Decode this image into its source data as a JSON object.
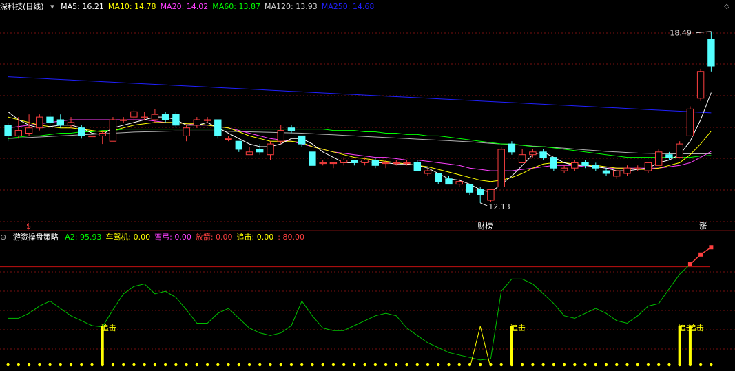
{
  "colors": {
    "bg": "#000000",
    "grid": "#7a1010",
    "up": "#ff4040",
    "down": "#54ffff",
    "ma5": "#ffffff",
    "ma10": "#ffff00",
    "ma20": "#ff40ff",
    "ma60": "#00ff00",
    "ma120": "#b0b0b0",
    "ma250": "#2020ff",
    "osc": "#00c000",
    "signal": "#ffff00",
    "ref": "#c01010",
    "label_red": "#ff4040"
  },
  "main_panel": {
    "title": "深科技(日线)",
    "legend": [
      {
        "key": "ma5",
        "label": "MA5:",
        "value": "16.21",
        "color": "#ffffff"
      },
      {
        "key": "ma10",
        "label": "MA10:",
        "value": "14.78",
        "color": "#ffff00"
      },
      {
        "key": "ma20",
        "label": "MA20:",
        "value": "14.02",
        "color": "#ff40ff"
      },
      {
        "key": "ma60",
        "label": "MA60:",
        "value": "13.87",
        "color": "#00ff00"
      },
      {
        "key": "ma120",
        "label": "MA120:",
        "value": "13.93",
        "color": "#d0d0d0"
      },
      {
        "key": "ma250",
        "label": "MA250:",
        "value": "14.68",
        "color": "#2020ff"
      }
    ],
    "high_marker": "18.49",
    "low_marker": "12.13",
    "event_labels": {
      "left": "$",
      "mid": "财榜",
      "right": "涨"
    }
  },
  "sub_panel": {
    "title": "游资操盘策略",
    "legend": [
      {
        "label": "A2:",
        "value": "95.93",
        "color": "#00ff00"
      },
      {
        "label": "车驾机:",
        "value": "0.00",
        "color": "#ffff00"
      },
      {
        "label": "弯弓:",
        "value": "0.00",
        "color": "#ff40ff"
      },
      {
        "label": "放箭:",
        "value": "0.00",
        "color": "#ff4040"
      },
      {
        "label": "追击:",
        "value": "0.00",
        "color": "#ffff00"
      },
      {
        "label": ":",
        "value": "80.00",
        "color": "#ff4040"
      }
    ],
    "signal_label": "追击"
  },
  "chart_data": {
    "type": "candlestick",
    "price_range": [
      11.2,
      19.2
    ],
    "candles": [
      {
        "o": 15.0,
        "c": 14.6,
        "h": 15.1,
        "l": 14.4
      },
      {
        "o": 14.6,
        "c": 14.8,
        "h": 15.3,
        "l": 14.5
      },
      {
        "o": 14.7,
        "c": 14.9,
        "h": 15.4,
        "l": 14.6
      },
      {
        "o": 14.9,
        "c": 15.3,
        "h": 15.4,
        "l": 14.8
      },
      {
        "o": 15.3,
        "c": 15.1,
        "h": 15.5,
        "l": 14.9
      },
      {
        "o": 15.2,
        "c": 15.0,
        "h": 15.4,
        "l": 14.9
      },
      {
        "o": 15.0,
        "c": 15.1,
        "h": 15.3,
        "l": 14.9
      },
      {
        "o": 14.9,
        "c": 14.6,
        "h": 15.0,
        "l": 14.5
      },
      {
        "o": 14.6,
        "c": 14.6,
        "h": 14.8,
        "l": 14.3
      },
      {
        "o": 14.6,
        "c": 14.7,
        "h": 14.8,
        "l": 14.3
      },
      {
        "o": 14.4,
        "c": 15.2,
        "h": 15.3,
        "l": 14.4
      },
      {
        "o": 15.2,
        "c": 15.2,
        "h": 15.3,
        "l": 15.1
      },
      {
        "o": 15.3,
        "c": 15.5,
        "h": 15.6,
        "l": 15.1
      },
      {
        "o": 15.3,
        "c": 15.3,
        "h": 15.5,
        "l": 15.2
      },
      {
        "o": 15.2,
        "c": 15.4,
        "h": 15.6,
        "l": 15.1
      },
      {
        "o": 15.4,
        "c": 15.2,
        "h": 15.5,
        "l": 15.1
      },
      {
        "o": 15.4,
        "c": 15.0,
        "h": 15.5,
        "l": 14.9
      },
      {
        "o": 14.6,
        "c": 14.9,
        "h": 15.0,
        "l": 14.4
      },
      {
        "o": 15.0,
        "c": 15.2,
        "h": 15.3,
        "l": 14.9
      },
      {
        "o": 15.2,
        "c": 15.2,
        "h": 15.3,
        "l": 15.1
      },
      {
        "o": 15.2,
        "c": 14.6,
        "h": 15.2,
        "l": 14.5
      },
      {
        "o": 14.5,
        "c": 14.5,
        "h": 14.6,
        "l": 14.4
      },
      {
        "o": 14.4,
        "c": 14.1,
        "h": 14.4,
        "l": 14.0
      },
      {
        "o": 13.9,
        "c": 14.0,
        "h": 14.2,
        "l": 13.9
      },
      {
        "o": 14.1,
        "c": 14.0,
        "h": 14.3,
        "l": 13.9
      },
      {
        "o": 13.9,
        "c": 14.3,
        "h": 14.4,
        "l": 13.7
      },
      {
        "o": 14.4,
        "c": 14.8,
        "h": 15.0,
        "l": 14.3
      },
      {
        "o": 14.9,
        "c": 14.8,
        "h": 15.0,
        "l": 14.7
      },
      {
        "o": 14.6,
        "c": 14.3,
        "h": 14.6,
        "l": 14.2
      },
      {
        "o": 14.0,
        "c": 13.5,
        "h": 14.0,
        "l": 13.5
      },
      {
        "o": 13.6,
        "c": 13.6,
        "h": 13.7,
        "l": 13.5
      },
      {
        "o": 13.6,
        "c": 13.6,
        "h": 13.6,
        "l": 13.4
      },
      {
        "o": 13.6,
        "c": 13.7,
        "h": 13.8,
        "l": 13.5
      },
      {
        "o": 13.7,
        "c": 13.6,
        "h": 13.7,
        "l": 13.5
      },
      {
        "o": 13.6,
        "c": 13.7,
        "h": 13.8,
        "l": 13.5
      },
      {
        "o": 13.7,
        "c": 13.5,
        "h": 13.8,
        "l": 13.4
      },
      {
        "o": 13.6,
        "c": 13.6,
        "h": 13.7,
        "l": 13.4
      },
      {
        "o": 13.6,
        "c": 13.6,
        "h": 13.7,
        "l": 13.5
      },
      {
        "o": 13.6,
        "c": 13.6,
        "h": 13.7,
        "l": 13.5
      },
      {
        "o": 13.6,
        "c": 13.3,
        "h": 13.7,
        "l": 13.3
      },
      {
        "o": 13.2,
        "c": 13.3,
        "h": 13.4,
        "l": 13.1
      },
      {
        "o": 13.2,
        "c": 12.9,
        "h": 13.2,
        "l": 12.8
      },
      {
        "o": 13.0,
        "c": 12.8,
        "h": 13.1,
        "l": 12.8
      },
      {
        "o": 12.8,
        "c": 12.9,
        "h": 13.0,
        "l": 12.7
      },
      {
        "o": 12.8,
        "c": 12.5,
        "h": 12.8,
        "l": 12.4
      },
      {
        "o": 12.6,
        "c": 12.4,
        "h": 12.7,
        "l": 12.1
      },
      {
        "o": 12.2,
        "c": 12.6,
        "h": 12.6,
        "l": 12.13
      },
      {
        "o": 12.7,
        "c": 14.1,
        "h": 14.2,
        "l": 12.7
      },
      {
        "o": 14.3,
        "c": 14.0,
        "h": 14.4,
        "l": 13.9
      },
      {
        "o": 13.6,
        "c": 13.9,
        "h": 14.1,
        "l": 13.6
      },
      {
        "o": 13.9,
        "c": 14.0,
        "h": 14.1,
        "l": 13.8
      },
      {
        "o": 14.0,
        "c": 13.8,
        "h": 14.1,
        "l": 13.7
      },
      {
        "o": 13.8,
        "c": 13.4,
        "h": 13.8,
        "l": 13.3
      },
      {
        "o": 13.3,
        "c": 13.4,
        "h": 13.5,
        "l": 13.2
      },
      {
        "o": 13.4,
        "c": 13.6,
        "h": 13.7,
        "l": 13.3
      },
      {
        "o": 13.6,
        "c": 13.5,
        "h": 13.7,
        "l": 13.4
      },
      {
        "o": 13.5,
        "c": 13.4,
        "h": 13.6,
        "l": 13.3
      },
      {
        "o": 13.3,
        "c": 13.2,
        "h": 13.4,
        "l": 13.1
      },
      {
        "o": 13.1,
        "c": 13.3,
        "h": 13.3,
        "l": 13.0
      },
      {
        "o": 13.2,
        "c": 13.4,
        "h": 13.5,
        "l": 13.1
      },
      {
        "o": 13.4,
        "c": 13.4,
        "h": 13.5,
        "l": 13.3
      },
      {
        "o": 13.3,
        "c": 13.6,
        "h": 13.6,
        "l": 13.2
      },
      {
        "o": 13.5,
        "c": 14.0,
        "h": 14.1,
        "l": 13.5
      },
      {
        "o": 13.9,
        "c": 13.8,
        "h": 14.0,
        "l": 13.7
      },
      {
        "o": 13.8,
        "c": 14.3,
        "h": 14.4,
        "l": 13.8
      },
      {
        "o": 14.6,
        "c": 15.6,
        "h": 15.7,
        "l": 14.6
      },
      {
        "o": 16.0,
        "c": 17.0,
        "h": 17.1,
        "l": 15.9
      },
      {
        "o": 18.2,
        "c": 17.2,
        "h": 18.49,
        "l": 17.0
      }
    ],
    "ma5": [
      15.5,
      15.2,
      15.0,
      14.9,
      14.95,
      15.0,
      15.0,
      14.9,
      14.7,
      14.65,
      14.9,
      15.0,
      15.1,
      15.2,
      15.3,
      15.3,
      15.2,
      15.0,
      15.0,
      15.1,
      14.9,
      14.7,
      14.5,
      14.3,
      14.2,
      14.2,
      14.3,
      14.5,
      14.5,
      14.3,
      14.0,
      13.8,
      13.6,
      13.6,
      13.65,
      13.6,
      13.6,
      13.55,
      13.55,
      13.5,
      13.4,
      13.2,
      13.0,
      12.95,
      12.8,
      12.6,
      12.5,
      12.8,
      13.1,
      13.5,
      13.9,
      14.0,
      13.8,
      13.6,
      13.5,
      13.5,
      13.45,
      13.4,
      13.3,
      13.3,
      13.35,
      13.4,
      13.6,
      13.7,
      13.9,
      14.4,
      15.2,
      16.21
    ],
    "ma10": [
      15.3,
      15.2,
      15.1,
      15.0,
      14.95,
      14.9,
      14.9,
      14.85,
      14.8,
      14.75,
      14.8,
      14.9,
      15.0,
      15.05,
      15.1,
      15.1,
      15.1,
      15.05,
      15.05,
      15.0,
      14.95,
      14.9,
      14.75,
      14.6,
      14.5,
      14.4,
      14.4,
      14.4,
      14.35,
      14.2,
      14.1,
      14.0,
      13.9,
      13.8,
      13.75,
      13.7,
      13.65,
      13.6,
      13.55,
      13.5,
      13.45,
      13.35,
      13.25,
      13.15,
      13.05,
      12.95,
      12.9,
      12.95,
      13.05,
      13.2,
      13.4,
      13.55,
      13.6,
      13.6,
      13.55,
      13.5,
      13.5,
      13.45,
      13.4,
      13.4,
      13.35,
      13.35,
      13.4,
      13.5,
      13.6,
      13.9,
      14.3,
      14.78
    ],
    "ma20": [
      14.9,
      14.95,
      15.0,
      15.05,
      15.1,
      15.15,
      15.2,
      15.2,
      15.2,
      15.2,
      15.2,
      15.2,
      15.2,
      15.2,
      15.15,
      15.1,
      15.1,
      15.05,
      15.0,
      15.0,
      14.95,
      14.9,
      14.8,
      14.7,
      14.6,
      14.5,
      14.45,
      14.4,
      14.3,
      14.2,
      14.1,
      14.0,
      13.95,
      13.9,
      13.85,
      13.8,
      13.8,
      13.75,
      13.7,
      13.7,
      13.65,
      13.6,
      13.55,
      13.5,
      13.4,
      13.35,
      13.3,
      13.3,
      13.3,
      13.35,
      13.4,
      13.45,
      13.5,
      13.5,
      13.5,
      13.45,
      13.45,
      13.4,
      13.4,
      13.4,
      13.4,
      13.4,
      13.4,
      13.45,
      13.5,
      13.6,
      13.8,
      14.02
    ],
    "ma60": [
      14.5,
      14.55,
      14.6,
      14.6,
      14.65,
      14.7,
      14.7,
      14.75,
      14.75,
      14.8,
      14.8,
      14.85,
      14.85,
      14.85,
      14.85,
      14.85,
      14.85,
      14.85,
      14.85,
      14.85,
      14.85,
      14.85,
      14.85,
      14.85,
      14.85,
      14.85,
      14.85,
      14.85,
      14.85,
      14.85,
      14.85,
      14.8,
      14.8,
      14.8,
      14.75,
      14.75,
      14.7,
      14.7,
      14.65,
      14.65,
      14.6,
      14.6,
      14.55,
      14.5,
      14.45,
      14.4,
      14.35,
      14.3,
      14.3,
      14.25,
      14.2,
      14.2,
      14.15,
      14.1,
      14.05,
      14.0,
      13.95,
      13.9,
      13.85,
      13.8,
      13.8,
      13.8,
      13.8,
      13.8,
      13.8,
      13.8,
      13.85,
      13.87
    ],
    "ma120": [
      14.5,
      14.52,
      14.54,
      14.56,
      14.58,
      14.6,
      14.62,
      14.64,
      14.66,
      14.68,
      14.7,
      14.72,
      14.74,
      14.75,
      14.76,
      14.77,
      14.78,
      14.78,
      14.78,
      14.78,
      14.78,
      14.77,
      14.76,
      14.75,
      14.74,
      14.73,
      14.72,
      14.71,
      14.7,
      14.68,
      14.66,
      14.64,
      14.62,
      14.6,
      14.58,
      14.56,
      14.54,
      14.52,
      14.5,
      14.48,
      14.46,
      14.44,
      14.42,
      14.4,
      14.38,
      14.35,
      14.32,
      14.3,
      14.28,
      14.25,
      14.22,
      14.2,
      14.17,
      14.14,
      14.11,
      14.08,
      14.05,
      14.02,
      14.0,
      13.98,
      13.96,
      13.95,
      13.94,
      13.93,
      13.93,
      13.93,
      13.93,
      13.93
    ],
    "ma250": [
      16.8,
      16.78,
      16.76,
      16.74,
      16.72,
      16.7,
      16.68,
      16.66,
      16.64,
      16.62,
      16.6,
      16.58,
      16.56,
      16.54,
      16.52,
      16.5,
      16.48,
      16.46,
      16.44,
      16.42,
      16.4,
      16.38,
      16.36,
      16.34,
      16.32,
      16.3,
      16.28,
      16.26,
      16.24,
      16.22,
      16.2,
      16.18,
      16.16,
      16.14,
      16.12,
      16.1,
      16.08,
      16.06,
      16.04,
      16.02,
      16.0,
      15.98,
      15.96,
      15.94,
      15.92,
      15.9,
      15.88,
      15.86,
      15.84,
      15.82,
      15.8,
      15.78,
      15.76,
      15.74,
      15.72,
      15.7,
      15.68,
      15.66,
      15.64,
      15.62,
      15.6,
      15.58,
      15.56,
      15.54,
      15.52,
      15.5,
      15.48,
      15.46
    ],
    "oscillator": {
      "range": [
        0,
        100
      ],
      "reference_line": 80,
      "values": [
        38,
        38,
        42,
        48,
        52,
        46,
        40,
        36,
        32,
        31,
        45,
        58,
        64,
        66,
        58,
        60,
        55,
        45,
        34,
        34,
        42,
        46,
        38,
        30,
        26,
        24,
        26,
        32,
        52,
        40,
        30,
        28,
        28,
        32,
        36,
        40,
        42,
        40,
        30,
        24,
        18,
        14,
        10,
        8,
        6,
        4,
        5,
        60,
        70,
        70,
        66,
        58,
        50,
        40,
        38,
        42,
        46,
        42,
        36,
        34,
        40,
        48,
        50,
        62,
        74,
        82,
        90,
        95.93
      ],
      "signal_bars": [
        9,
        48,
        64,
        65
      ],
      "spike_index": 45
    }
  }
}
